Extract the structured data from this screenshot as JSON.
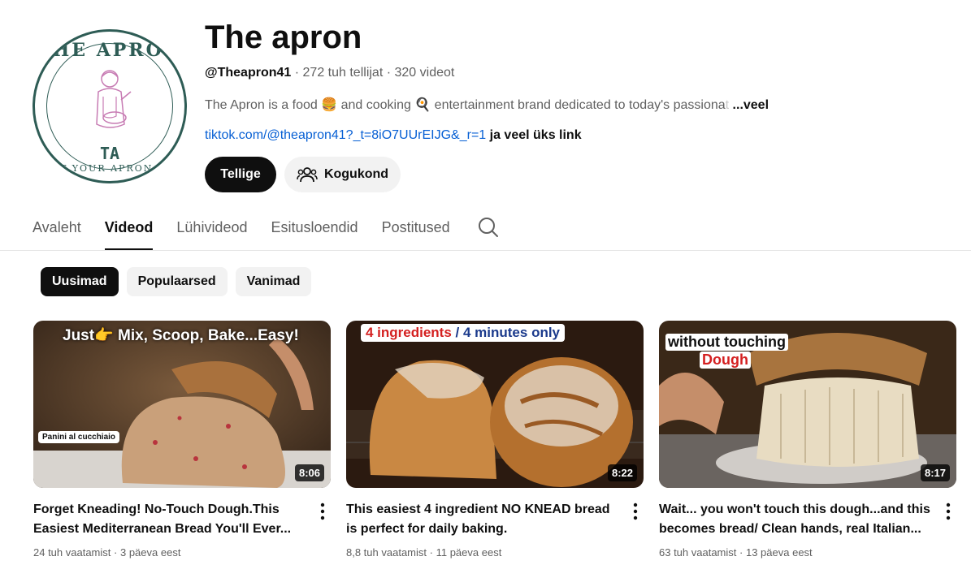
{
  "channel": {
    "avatar": {
      "top_text": "THE APRON",
      "monogram": "TA",
      "bottom_text": "PUT YOUR APRON ON"
    },
    "title": "The apron",
    "handle": "@Theapron41",
    "subscribers": "272 tuh tellijat",
    "videos_count": "320 videot",
    "separator": "·",
    "description_main": "The Apron is a food 🍔 and cooking 🍳 entertainment brand dedicated to today's passiona",
    "description_fade": "t",
    "description_more": "...veel",
    "link_text": "tiktok.com/@theapron41?_t=8iO7UUrEIJG&_r=1",
    "link_extra": "ja veel üks link",
    "subscribe_label": "Tellige",
    "community_label": "Kogukond"
  },
  "tabs": [
    {
      "label": "Avaleht"
    },
    {
      "label": "Videod"
    },
    {
      "label": "Lühivideod"
    },
    {
      "label": "Esitusloendid"
    },
    {
      "label": "Postitused"
    }
  ],
  "chips": [
    {
      "label": "Uusimad"
    },
    {
      "label": "Populaarsed"
    },
    {
      "label": "Vanimad"
    }
  ],
  "videos": [
    {
      "title": "Forget Kneading! No-Touch Dough.This Easiest Mediterranean Bread You'll Ever...",
      "views": "24 tuh vaatamist",
      "age": "3 päeva eest",
      "duration": "8:06",
      "thumb_caption": "Just👉 Mix, Scoop, Bake...Easy!",
      "thumb_tag": "Panini al cucchiaio"
    },
    {
      "title": "This easiest 4 ingredient NO KNEAD bread is perfect for daily baking.",
      "views": "8,8 tuh vaatamist",
      "age": "11 päeva eest",
      "duration": "8:22",
      "thumb_caption_a": "4 ingredients",
      "thumb_caption_sep": " / ",
      "thumb_caption_b": "4 minutes only"
    },
    {
      "title": "Wait... you won't touch this dough...and this becomes bread/ Clean hands, real Italian...",
      "views": "63 tuh vaatamist",
      "age": "13 päeva eest",
      "duration": "8:17",
      "thumb_caption_a": "without touching",
      "thumb_caption_b": "Dough"
    }
  ],
  "colors": {
    "brand_green": "#2e5c55",
    "link_blue": "#065fd4",
    "accent_red": "#d42020"
  }
}
